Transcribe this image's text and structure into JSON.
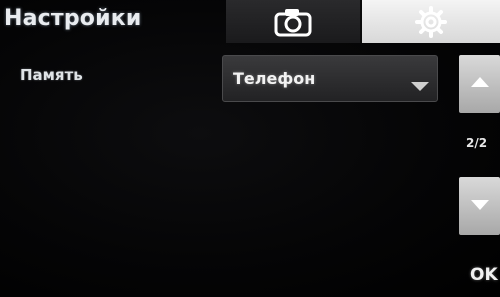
{
  "header": {
    "title": "Настройки"
  },
  "tabs": [
    {
      "icon": "camera-icon",
      "active": false
    },
    {
      "icon": "gear-icon",
      "active": true
    }
  ],
  "settings": {
    "memory_label": "Память",
    "memory_value": "Телефон"
  },
  "pager": {
    "indicator": "2/2"
  },
  "actions": {
    "ok_label": "OK"
  },
  "colors": {
    "background": "#000000",
    "active_tab": "#e6e6e6",
    "inactive_tab": "#222224",
    "scroll_button": "#c2c2c2"
  }
}
